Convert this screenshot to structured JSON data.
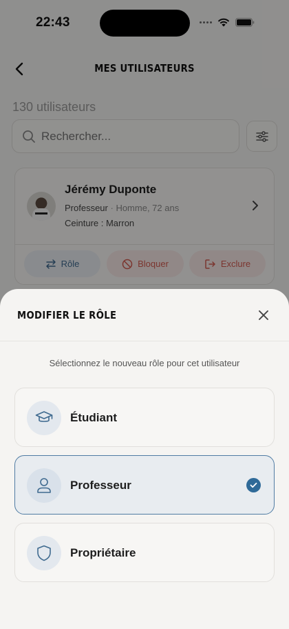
{
  "status_bar": {
    "time": "22:43"
  },
  "nav": {
    "title": "MES UTILISATEURS"
  },
  "list": {
    "count_label": "130 utilisateurs",
    "search_placeholder": "Rechercher..."
  },
  "user": {
    "name": "Jérémy Duponte",
    "role": "Professeur",
    "separator": " · ",
    "details": "Homme, 72 ans",
    "belt": "Ceinture : Marron",
    "actions": {
      "role_label": "Rôle",
      "block_label": "Bloquer",
      "exclude_label": "Exclure"
    }
  },
  "sheet": {
    "title": "MODIFIER LE RÔLE",
    "subtitle": "Sélectionnez le nouveau rôle pour cet utilisateur",
    "options": [
      {
        "label": "Étudiant",
        "icon": "graduation-cap-icon",
        "selected": false
      },
      {
        "label": "Professeur",
        "icon": "person-icon",
        "selected": true
      },
      {
        "label": "Propriétaire",
        "icon": "shield-icon",
        "selected": false
      }
    ]
  },
  "colors": {
    "accent": "#2f6a98",
    "danger": "#d25b50",
    "background": "#f4f3f1"
  }
}
